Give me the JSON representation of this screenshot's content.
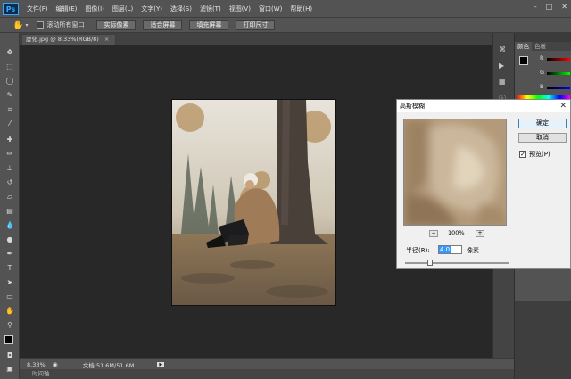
{
  "app": {
    "logo": "Ps"
  },
  "menubar": {
    "items": [
      "文件(F)",
      "编辑(E)",
      "图像(I)",
      "图层(L)",
      "文字(Y)",
      "选择(S)",
      "滤镜(T)",
      "视图(V)",
      "窗口(W)",
      "帮助(H)"
    ]
  },
  "window_controls": {
    "minimize": "–",
    "restore": "□",
    "close": "✕"
  },
  "options_bar": {
    "tool_icon": "hand-icon",
    "scroll_all_label": "滚动所有窗口",
    "buttons": [
      "实际像素",
      "适合屏幕",
      "填充屏幕",
      "打印尺寸"
    ]
  },
  "document": {
    "tab_title": "虚化.jpg @ 8.33%(RGB/8)",
    "tab_close": "×"
  },
  "status": {
    "zoom": "8.33%",
    "doc_info": "文档:51.6M/51.6M",
    "arrow": "▶"
  },
  "timeline": {
    "label": "时间轴"
  },
  "right_panel": {
    "tabs": [
      "颜色",
      "色板"
    ],
    "channels": [
      "R",
      "G",
      "B"
    ]
  },
  "dialog": {
    "title": "高斯模糊",
    "close": "✕",
    "ok": "确定",
    "cancel": "取消",
    "preview_label": "预览(P)",
    "preview_checked": true,
    "zoom_out": "−",
    "zoom": "100%",
    "zoom_in": "+",
    "radius_label": "半径(R):",
    "radius_value": "4.0",
    "radius_unit": "像素",
    "radius_fraction": 0.22
  },
  "colors": {
    "accent": "#31a8ff",
    "ui_bg": "#535353",
    "canvas_bg": "#282828",
    "dialog_bg": "#f0f0f0"
  }
}
